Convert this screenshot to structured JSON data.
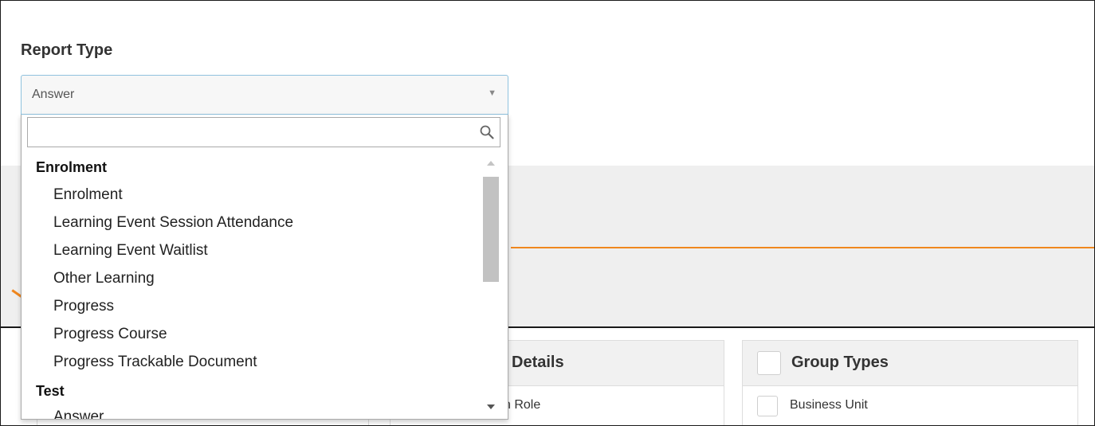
{
  "report_type": {
    "label": "Report Type",
    "selected": "Answer",
    "search_placeholder": ""
  },
  "dropdown": {
    "groups": [
      {
        "label": "Enrolment",
        "options": [
          "Enrolment",
          "Learning Event Session Attendance",
          "Learning Event Waitlist",
          "Other Learning",
          "Progress",
          "Progress Course",
          "Progress Trackable Document"
        ]
      },
      {
        "label": "Test",
        "options": [
          "Answer"
        ]
      }
    ]
  },
  "background": {
    "details_title": "Details",
    "details_row": "n Role",
    "group_types_title": "Group Types",
    "group_types_row": "Business Unit"
  },
  "colors": {
    "accent_orange": "#f0871e",
    "select_border": "#8fc2de"
  },
  "icons": {
    "search": "search-icon",
    "dropdown_arrow": "caret-down-icon"
  }
}
